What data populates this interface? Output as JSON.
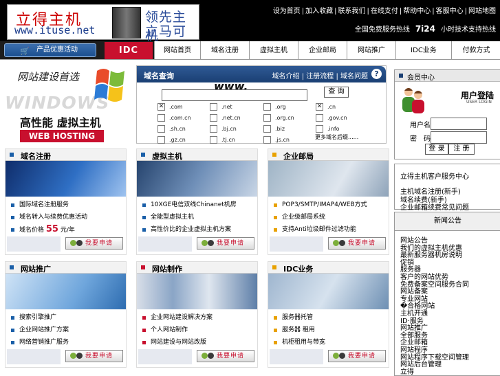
{
  "header": {
    "logo_cn": "立得主机",
    "logo_url": "www.ituse.net",
    "tagline_1": "领先主机",
    "tagline_2": "立马可得",
    "top_links": [
      "设为首页",
      "加入收藏",
      "联系我们",
      "在线支付",
      "帮助中心",
      "客服中心",
      "网站地图"
    ],
    "hotline_label": "全国免费服务热线",
    "hotline_badge": "7i24",
    "hotline_tail": "小时技术支持热线"
  },
  "nav": {
    "promo_label": "产品优惠活动",
    "idc_badge": "IDC",
    "tabs": [
      "网站首页",
      "域名注册",
      "虚拟主机",
      "企业邮局",
      "网站推广",
      "IDC业务",
      "付款方式"
    ]
  },
  "banner": {
    "line1": "网站建设首选",
    "watermark": "WINDOWS",
    "line2": "高性能 虚拟主机",
    "line3": "WEB HOSTING"
  },
  "domain": {
    "title": "域名查询",
    "links": [
      "域名介绍",
      "注册流程",
      "域名问题"
    ],
    "www": "www.",
    "input_value": "",
    "submit": "查 询",
    "tlds": [
      {
        "label": ".com",
        "checked": true
      },
      {
        "label": ".net",
        "checked": false
      },
      {
        "label": ".org",
        "checked": false
      },
      {
        "label": ".cn",
        "checked": true
      },
      {
        "label": ".com.cn",
        "checked": false
      },
      {
        "label": ".net.cn",
        "checked": false
      },
      {
        "label": ".org.cn",
        "checked": false
      },
      {
        "label": ".gov.cn",
        "checked": false
      },
      {
        "label": ".sh.cn",
        "checked": false
      },
      {
        "label": ".bj.cn",
        "checked": false
      },
      {
        "label": ".biz",
        "checked": false
      },
      {
        "label": ".info",
        "checked": false
      },
      {
        "label": ".gz.cn",
        "checked": false
      },
      {
        "label": ".tj.cn",
        "checked": false
      },
      {
        "label": ".js.cn",
        "checked": false
      }
    ],
    "more": "更多域名后缀......"
  },
  "login": {
    "section": "会员中心",
    "title": "用户登陆",
    "subtitle": "USER LOGIN",
    "user_label": "用户名：",
    "pass_label": "密　码：",
    "login_btn": "登 录",
    "register_btn": "注 册"
  },
  "right_box1": {
    "heading": "立得主机客户服务中心",
    "items": [
      "主机域名注册(新手)",
      "域名续费(新手)",
      "企业邮箱续费常见问题"
    ]
  },
  "right_box2": {
    "heading": "新闻公告",
    "items": [
      "网站公告",
      "我们的虚拟主机优惠",
      "最新服务器机房说明",
      "促销",
      "服务器",
      "客户的网站优势",
      "免费备案空间服务合同",
      "网站备案",
      "专业网站",
      "�合格网站",
      "主机开通",
      "ID·服务",
      "网站推广",
      "全部服务",
      "企业邮箱",
      "网站程序",
      "网站程序下载空间管理",
      "网站后台管理",
      "立得"
    ]
  },
  "panels": [
    {
      "title": "域名注册",
      "color": "#1a5fa8",
      "items": [
        "国际域名注册服务",
        "域名转入与续费优惠活动",
        "域名价格 55 元/年"
      ],
      "price_prefix": "域名价格",
      "price": "55",
      "price_suffix": "元/年",
      "button": "我要申请"
    },
    {
      "title": "虚拟主机",
      "color": "#1a5fa8",
      "items": [
        "10XGE电信双线Chinanet机房",
        "全能型虚拟主机",
        "高性价比的企业虚拟主机方案"
      ],
      "button": "我要申请"
    },
    {
      "title": "企业邮局",
      "color": "#e8a100",
      "items": [
        "POP3/SMTP/IMAP4/WEB方式",
        "企业级邮局系统",
        "支持Anti垃圾邮件过滤功能"
      ],
      "button": "我要申请"
    },
    {
      "title": "网站推广",
      "color": "#1a5fa8",
      "items": [
        "搜索引擎推广",
        "企业网站推广方案",
        "网络营销推广服务"
      ],
      "button": "我要申请"
    },
    {
      "title": "网站制作",
      "color": "#c8102e",
      "items": [
        "企业网站建设解决方案",
        "个人网站制作",
        "网站建设与网站改版"
      ],
      "button": "我要申请"
    },
    {
      "title": "IDC业务",
      "color": "#e8a100",
      "items": [
        "服务器托管",
        "服务器 租用",
        "机柜租用与带宽"
      ],
      "button": "我要申请"
    }
  ],
  "colors": {
    "accent": "#c8102e",
    "header_bg": "#000000",
    "nav_blue": "#1a3f73"
  }
}
